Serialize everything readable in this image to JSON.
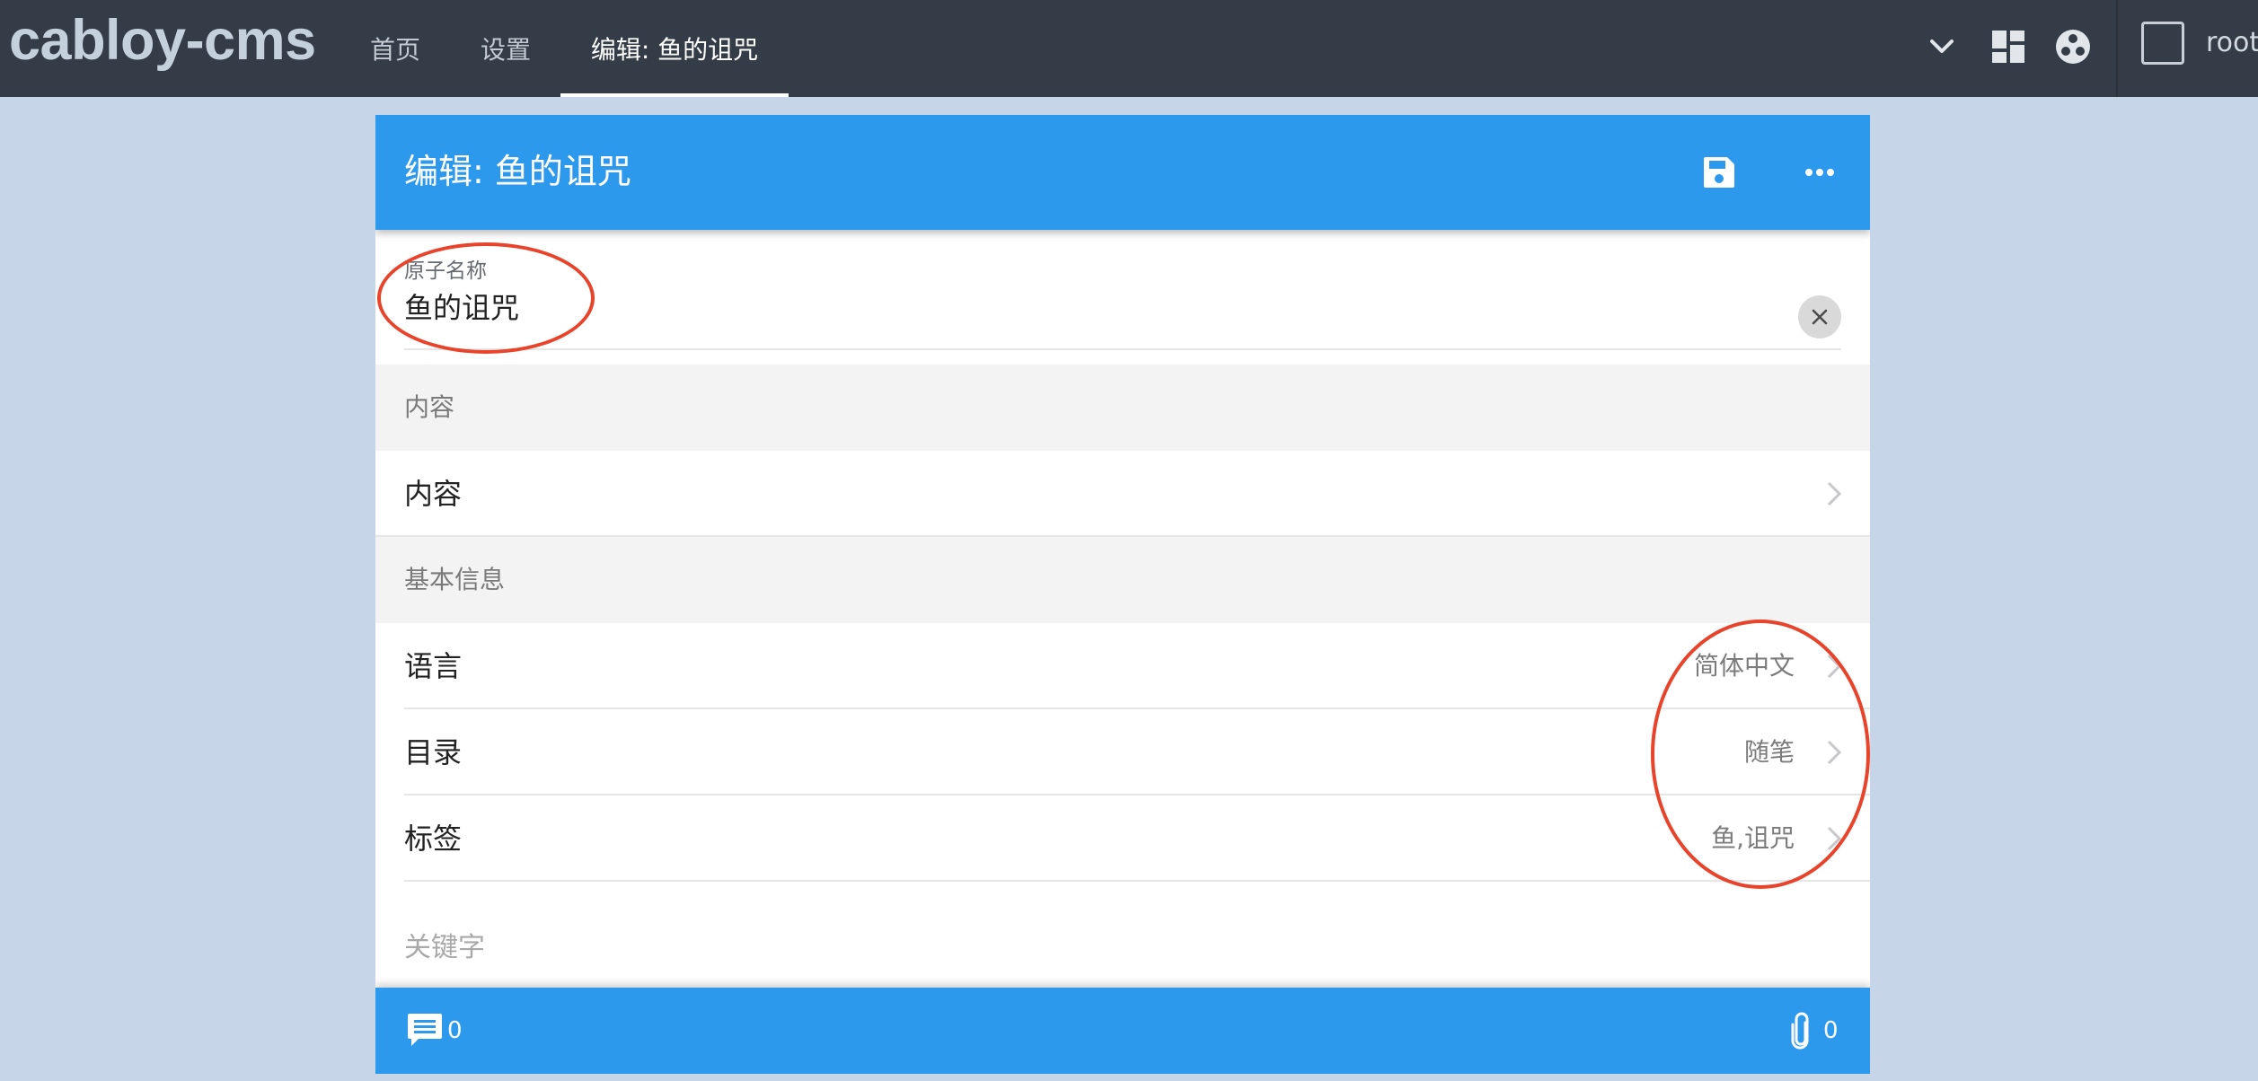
{
  "app": {
    "brand": "cabloy-cms",
    "tabs": [
      {
        "label": "首页",
        "active": false
      },
      {
        "label": "设置",
        "active": false
      },
      {
        "label": "编辑: 鱼的诅咒",
        "active": true
      }
    ],
    "icons": [
      "chevron-down-icon",
      "dashboard-icon",
      "cabloy-logo-icon"
    ],
    "user": {
      "name": "root"
    }
  },
  "card": {
    "title": "编辑: 鱼的诅咒",
    "header_actions": [
      "save-icon",
      "more-icon"
    ],
    "name_field": {
      "label": "原子名称",
      "value": "鱼的诅咒"
    },
    "sections": [
      {
        "header": "内容",
        "items": [
          {
            "title": "内容",
            "after": ""
          }
        ]
      },
      {
        "header": "基本信息",
        "items": [
          {
            "title": "语言",
            "after": "简体中文"
          },
          {
            "title": "目录",
            "after": "随笔"
          },
          {
            "title": "标签",
            "after": "鱼,诅咒"
          }
        ]
      }
    ],
    "keywords_label": "关键字",
    "footer": {
      "comments_count": "0",
      "attachments_count": "0"
    }
  },
  "colors": {
    "topbar": "#343c47",
    "primary": "#2d99ed",
    "page_bg": "#c7d5e8",
    "annotation": "#e8442c"
  }
}
